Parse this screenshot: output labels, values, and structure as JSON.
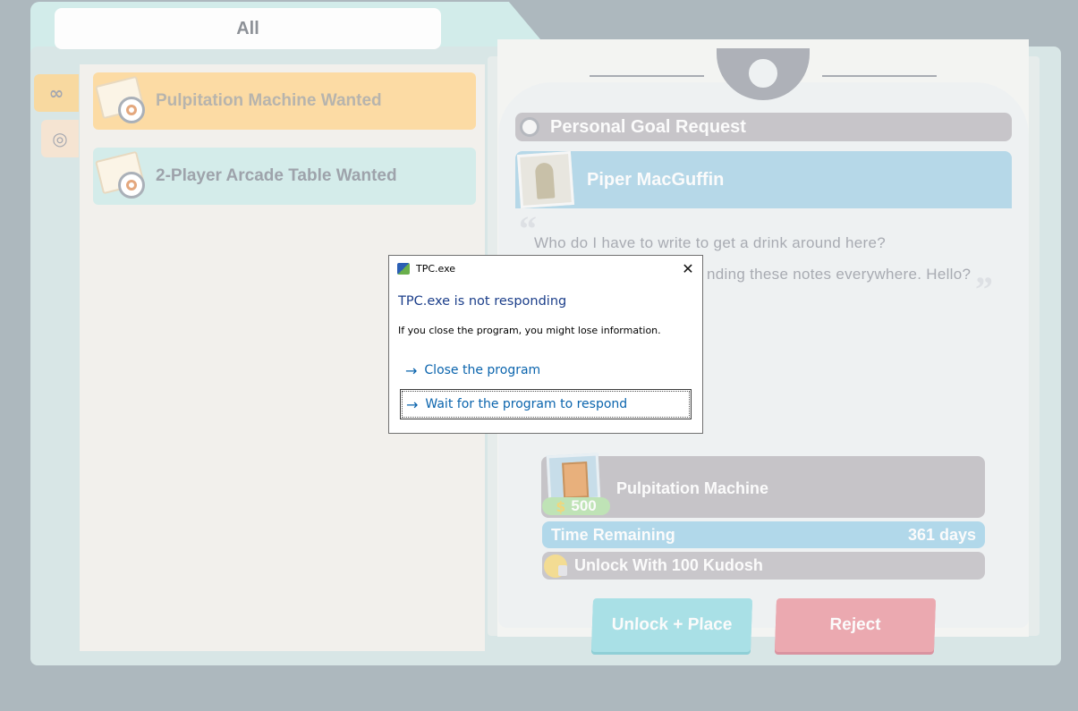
{
  "filter": {
    "label": "All"
  },
  "side_tabs": [
    {
      "name": "infinite",
      "icon": "infinity-icon",
      "glyph": "∞"
    },
    {
      "name": "goals",
      "icon": "target-icon",
      "glyph": "◎"
    }
  ],
  "quests": [
    {
      "label": "Pulpitation Machine Wanted",
      "icon": "envelope-icon"
    },
    {
      "label": "2-Player Arcade Table Wanted",
      "icon": "envelope-icon"
    }
  ],
  "request": {
    "title": "Personal Goal Request",
    "npc_name": "Piper MacGuffin",
    "speech_line_1": "Who do I have to write to get a drink around here?",
    "speech_line_2": "nding these notes everywhere. Hello?",
    "quote_open": "“",
    "quote_close": "”"
  },
  "item": {
    "name": "Pulpitation Machine",
    "price": "500",
    "coin_glyph": "$",
    "time_label": "Time Remaining",
    "time_value": "361 days",
    "unlock_label": "Unlock With 100 Kudosh"
  },
  "buttons": {
    "unlock": "Unlock + Place",
    "reject": "Reject"
  },
  "dialog": {
    "title": "TPC.exe",
    "heading": "TPC.exe is not responding",
    "message": "If you close the program, you might lose information.",
    "close_glyph": "✕",
    "arrow_glyph": "→",
    "options": [
      "Close the program",
      "Wait for the program to respond"
    ]
  }
}
